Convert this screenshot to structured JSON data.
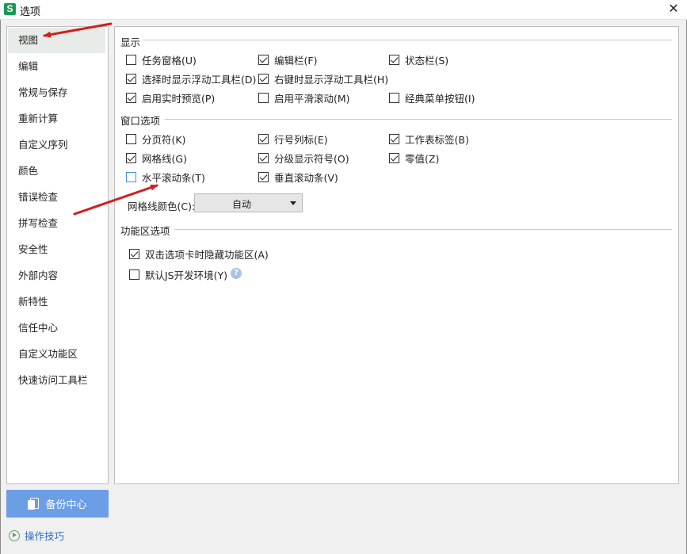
{
  "window": {
    "title": "选项",
    "app_icon_letter": "S",
    "close_symbol": "✕"
  },
  "sidebar": {
    "items": [
      {
        "label": "视图",
        "active": true
      },
      {
        "label": "编辑"
      },
      {
        "label": "常规与保存"
      },
      {
        "label": "重新计算"
      },
      {
        "label": "自定义序列"
      },
      {
        "label": "颜色"
      },
      {
        "label": "错误检查"
      },
      {
        "label": "拼写检查"
      },
      {
        "label": "安全性"
      },
      {
        "label": "外部内容"
      },
      {
        "label": "新特性"
      },
      {
        "label": "信任中心"
      },
      {
        "label": "自定义功能区"
      },
      {
        "label": "快速访问工具栏"
      }
    ]
  },
  "display": {
    "title": "显示",
    "options": [
      {
        "label": "任务窗格(U)",
        "checked": false
      },
      {
        "label": "编辑栏(F)",
        "checked": true
      },
      {
        "label": "状态栏(S)",
        "checked": true
      },
      {
        "label": "选择时显示浮动工具栏(D)",
        "checked": true
      },
      {
        "label": "右键时显示浮动工具栏(H)",
        "checked": true
      },
      {
        "label": "启用实时预览(P)",
        "checked": true
      },
      {
        "label": "启用平滑滚动(M)",
        "checked": false
      },
      {
        "label": "经典菜单按钮(I)",
        "checked": false
      }
    ]
  },
  "window_options": {
    "title": "窗口选项",
    "options": [
      {
        "label": "分页符(K)",
        "checked": false
      },
      {
        "label": "行号列标(E)",
        "checked": true
      },
      {
        "label": "工作表标签(B)",
        "checked": true
      },
      {
        "label": "网格线(G)",
        "checked": true
      },
      {
        "label": "分级显示符号(O)",
        "checked": true
      },
      {
        "label": "零值(Z)",
        "checked": true
      },
      {
        "label": "水平滚动条(T)",
        "checked": false
      },
      {
        "label": "垂直滚动条(V)",
        "checked": true
      }
    ],
    "grid_color_label": "网格线颜色(C):",
    "grid_color_value": "自动"
  },
  "ribbon": {
    "title": "功能区选项",
    "options": [
      {
        "label": "双击选项卡时隐藏功能区(A)",
        "checked": true
      },
      {
        "label": "默认JS开发环境(Y)",
        "checked": false
      }
    ],
    "help_symbol": "?"
  },
  "footer": {
    "backup_label": "备份中心",
    "tips_label": "操作技巧"
  },
  "colors": {
    "accent": "#6c9ee6",
    "app_icon": "#1a9a52",
    "arrow": "#d0201b",
    "link": "#2f6dc4"
  },
  "icons": [
    "close-icon",
    "app-icon",
    "backup-doc-icon",
    "play-circle-icon",
    "help-icon",
    "chevron-down-icon"
  ]
}
